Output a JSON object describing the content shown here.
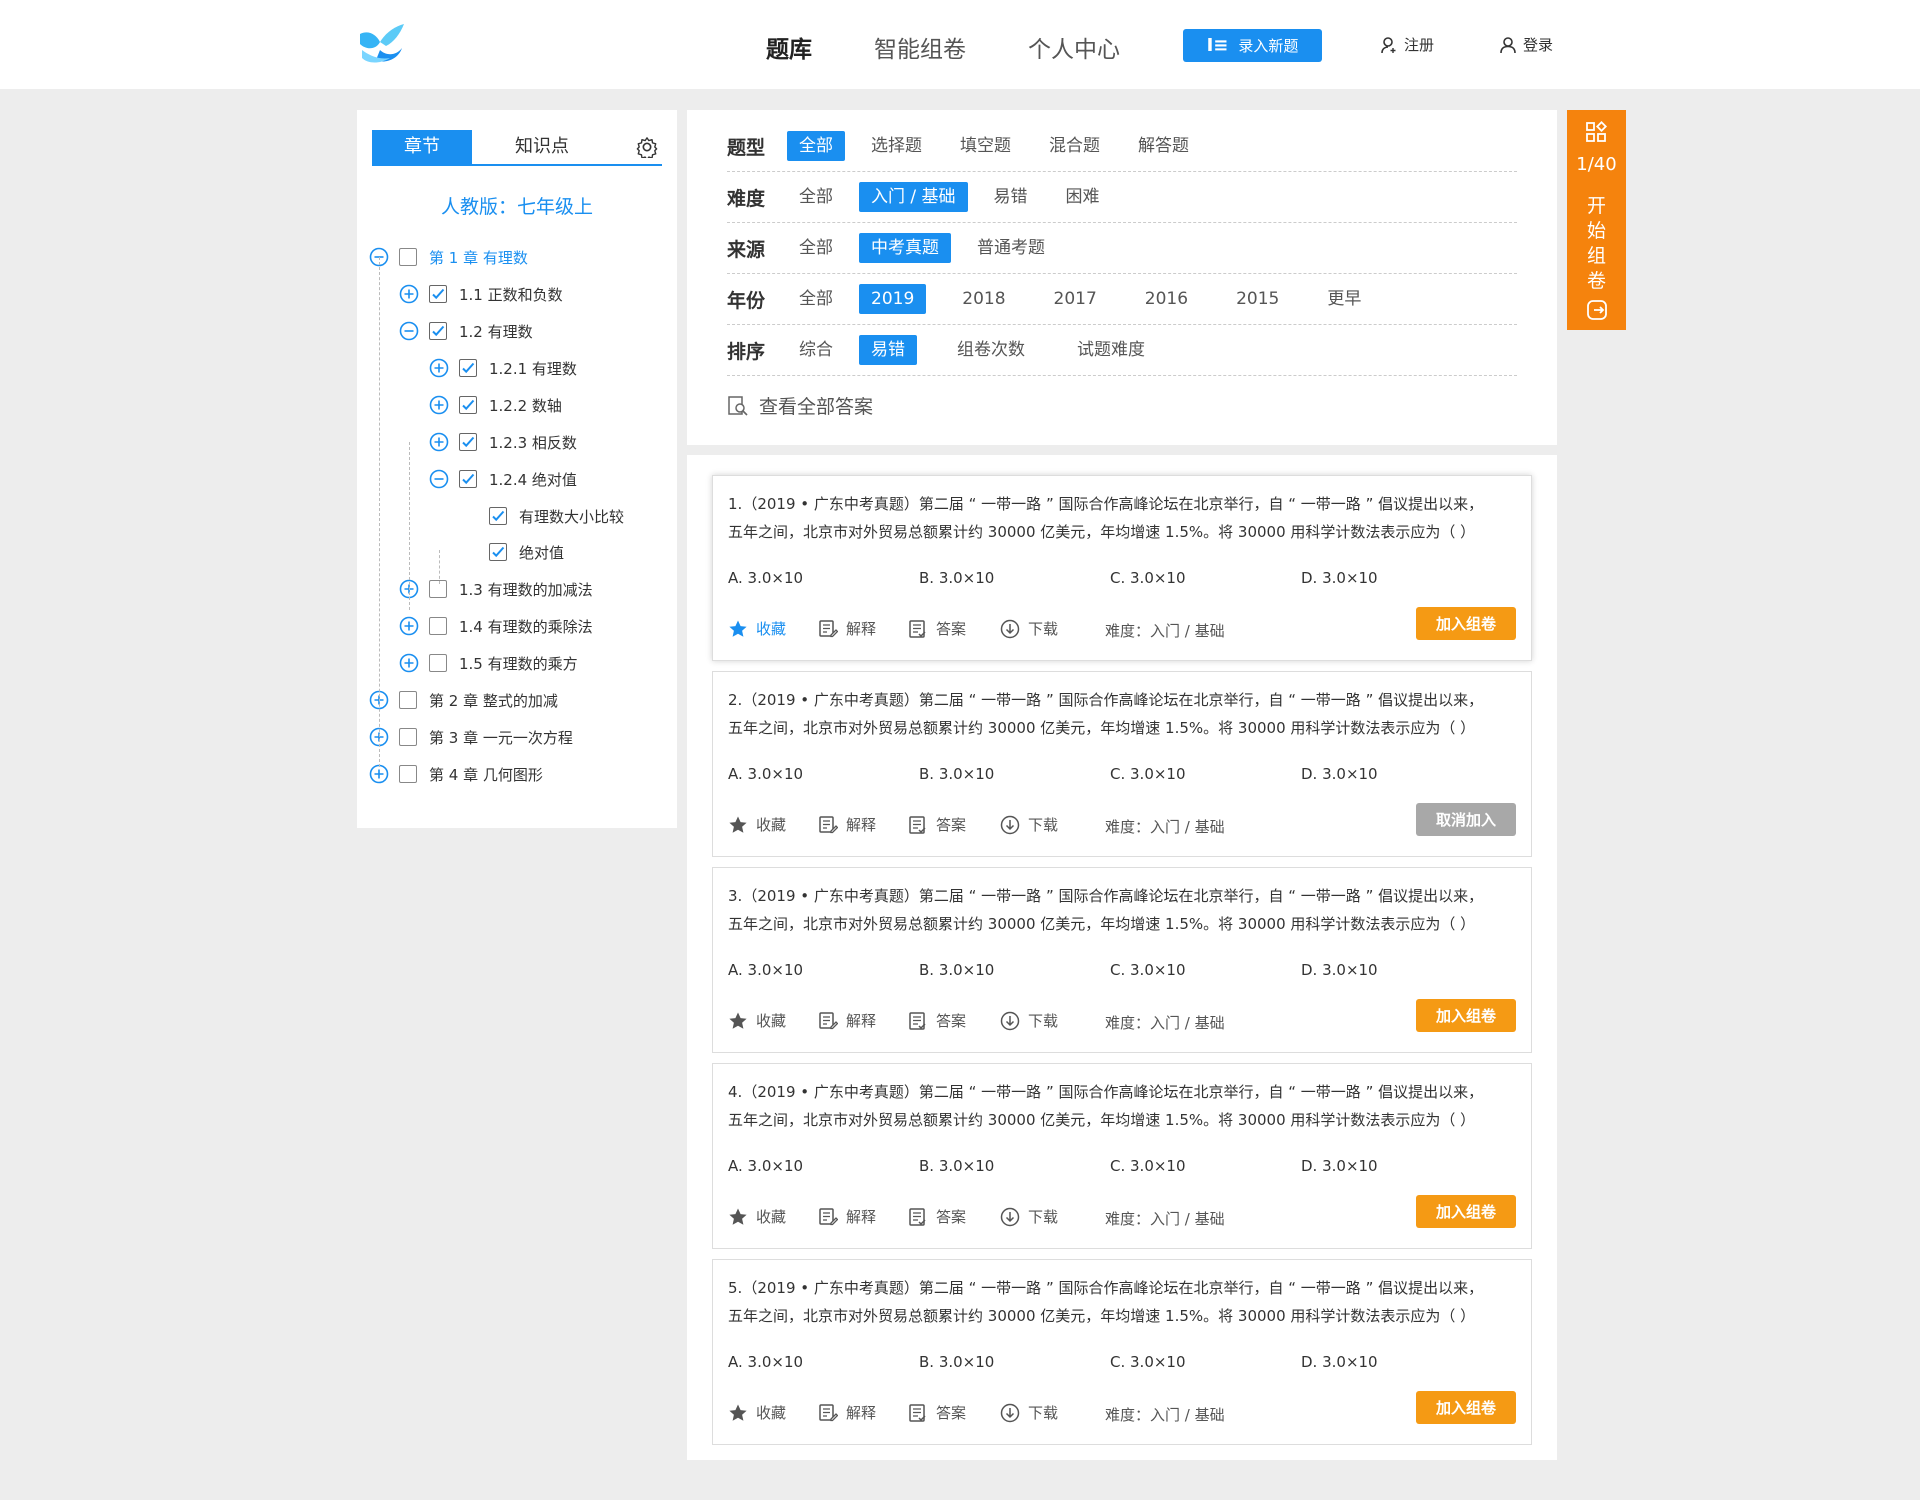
{
  "header": {
    "nav": [
      "题库",
      "智能组卷",
      "个人中心"
    ],
    "new_button": "录入新题",
    "register": "注册",
    "login": "登录"
  },
  "sidebar": {
    "tab_chapter": "章节",
    "tab_knowledge": "知识点",
    "book_title": "人教版：七年级上",
    "tree": [
      {
        "label": "第 1 章 有理数",
        "level": 0,
        "toggle": "minus",
        "checked": false,
        "highlight": true
      },
      {
        "label": "1.1 正数和负数",
        "level": 1,
        "toggle": "plus",
        "checked": true
      },
      {
        "label": "1.2 有理数",
        "level": 1,
        "toggle": "minus",
        "checked": true
      },
      {
        "label": "1.2.1 有理数",
        "level": 2,
        "toggle": "plus",
        "checked": true
      },
      {
        "label": "1.2.2 数轴",
        "level": 2,
        "toggle": "plus",
        "checked": true
      },
      {
        "label": "1.2.3 相反数",
        "level": 2,
        "toggle": "plus",
        "checked": true
      },
      {
        "label": "1.2.4 绝对值",
        "level": 2,
        "toggle": "minus",
        "checked": true
      },
      {
        "label": "有理数大小比较",
        "level": 3,
        "toggle": "none",
        "checked": true
      },
      {
        "label": "绝对值",
        "level": 3,
        "toggle": "none",
        "checked": true
      },
      {
        "label": "1.3 有理数的加减法",
        "level": 1,
        "toggle": "plus",
        "checked": false
      },
      {
        "label": "1.4 有理数的乘除法",
        "level": 1,
        "toggle": "plus",
        "checked": false
      },
      {
        "label": "1.5 有理数的乘方",
        "level": 1,
        "toggle": "plus",
        "checked": false
      },
      {
        "label": "第 2 章 整式的加减",
        "level": 0,
        "toggle": "plus",
        "checked": false
      },
      {
        "label": "第 3 章 一元一次方程",
        "level": 0,
        "toggle": "plus",
        "checked": false
      },
      {
        "label": "第 4 章 几何图形",
        "level": 0,
        "toggle": "plus",
        "checked": false
      }
    ]
  },
  "filters": {
    "rows": [
      {
        "label": "题型",
        "options": [
          "全部",
          "选择题",
          "填空题",
          "混合题",
          "解答题"
        ],
        "selected": 0
      },
      {
        "label": "难度",
        "options": [
          "全部",
          "入门 / 基础",
          "易错",
          "困难"
        ],
        "selected": 1
      },
      {
        "label": "来源",
        "options": [
          "全部",
          "中考真题",
          "普通考题"
        ],
        "selected": 1
      },
      {
        "label": "年份",
        "options": [
          "全部",
          "2019",
          "2018",
          "2017",
          "2016",
          "2015",
          "更早"
        ],
        "selected": 1
      },
      {
        "label": "排序",
        "options": [
          "综合",
          "易错",
          "组卷次数",
          "试题难度"
        ],
        "selected": 1
      }
    ],
    "view_all": "查看全部答案"
  },
  "question_common": {
    "line1": "（2019 • 广东中考真题）第二届 “ 一带一路 ” 国际合作高峰论坛在北京举行，自 “ 一带一路 ” 倡议提出以来，",
    "line2": "五年之间，北京市对外贸易总额累计约 30000 亿美元，年均增速 1.5%。将 30000 用科学计数法表示应为（   ）",
    "options": [
      "A.  3.0×10",
      "B.  3.0×10",
      "C.  3.0×10",
      "D.  3.0×10"
    ],
    "fav": "收藏",
    "explain": "解释",
    "answer": "答案",
    "download": "下载",
    "difficulty": "难度：入门 / 基础"
  },
  "questions": [
    {
      "num": "1.",
      "button": "加入组卷",
      "button_type": "add",
      "fav_on": true
    },
    {
      "num": "2.",
      "button": "取消加入",
      "button_type": "cancel",
      "fav_on": false
    },
    {
      "num": "3.",
      "button": "加入组卷",
      "button_type": "add",
      "fav_on": false
    },
    {
      "num": "4.",
      "button": "加入组卷",
      "button_type": "add",
      "fav_on": false
    },
    {
      "num": "5.",
      "button": "加入组卷",
      "button_type": "add",
      "fav_on": false
    }
  ],
  "side_float": {
    "count": "1/40",
    "text": "开始组卷"
  },
  "colors": {
    "accent": "#1a8ff0",
    "orange": "#f5830d",
    "button_add": "#f59a14",
    "button_cancel": "#a8a8a8"
  }
}
